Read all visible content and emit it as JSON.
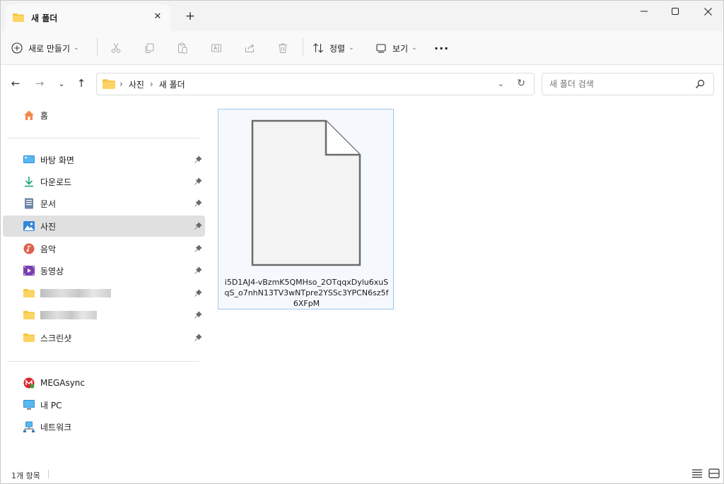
{
  "tab": {
    "title": "새 폴더",
    "close_icon": "close-icon",
    "new_tab_icon": "plus-icon"
  },
  "window": {
    "minimize": "minimize-icon",
    "maximize": "maximize-icon",
    "close": "close-icon"
  },
  "toolbar": {
    "new_label": "새로 만들기",
    "sort_label": "정렬",
    "view_label": "보기",
    "more_label": "···",
    "icons": [
      "cut-icon",
      "copy-icon",
      "paste-icon",
      "rename-icon",
      "share-icon",
      "delete-icon"
    ]
  },
  "address": {
    "crumbs": [
      "사진",
      "새 폴더"
    ],
    "search_placeholder": "새 폴더 검색"
  },
  "sidebar": {
    "home": "홈",
    "quick": [
      {
        "label": "바탕 화면",
        "icon": "desktop-icon"
      },
      {
        "label": "다운로드",
        "icon": "download-icon"
      },
      {
        "label": "문서",
        "icon": "document-icon"
      },
      {
        "label": "사진",
        "icon": "pictures-icon",
        "selected": true
      },
      {
        "label": "음악",
        "icon": "music-icon"
      },
      {
        "label": "동영상",
        "icon": "video-icon"
      },
      {
        "label": "",
        "icon": "folder-icon",
        "redacted": true
      },
      {
        "label": "",
        "icon": "folder-icon",
        "redacted": true
      },
      {
        "label": "스크린샷",
        "icon": "folder-icon"
      }
    ],
    "roots": [
      {
        "label": "MEGAsync",
        "icon": "mega-icon"
      },
      {
        "label": "내 PC",
        "icon": "pc-icon"
      },
      {
        "label": "네트워크",
        "icon": "network-icon"
      }
    ]
  },
  "file": {
    "name": "i5D1AJ4-vBzmK5QMHso_2OTqqxDylu6xuSqS_o7nhN13TV3wNTpre2YSSc3YPCN6sz5f6XFpM",
    "icon": "file-icon"
  },
  "status": {
    "count": "1개 항목"
  },
  "colors": {
    "folder": "#f5c542",
    "selection_border": "#9dc7ee",
    "selection_fill": "#f5f9fd",
    "sidebar_selected": "#e0e0e0"
  }
}
